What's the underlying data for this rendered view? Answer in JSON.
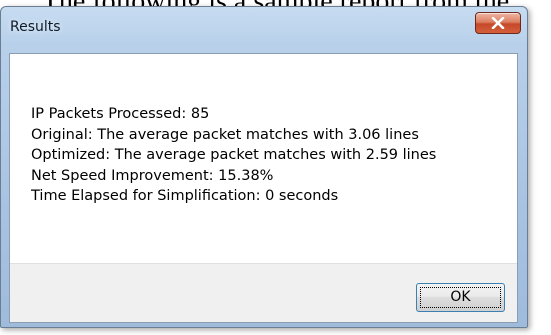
{
  "background_text": "The following is a sample report from the",
  "dialog": {
    "title": "Results",
    "lines": [
      "IP Packets Processed: 85",
      "Original: The average packet matches with 3.06 lines",
      "Optimized: The average packet matches with 2.59 lines",
      "Net Speed Improvement: 15.38%",
      "Time Elapsed for Simplification: 0 seconds"
    ],
    "ok_label": "OK",
    "close_icon": "close-x-icon"
  },
  "colors": {
    "title_bar": "#b8d0ea",
    "close_button": "#c5482a",
    "footer": "#f0f0f0",
    "ok_border": "#3c7fb1"
  }
}
